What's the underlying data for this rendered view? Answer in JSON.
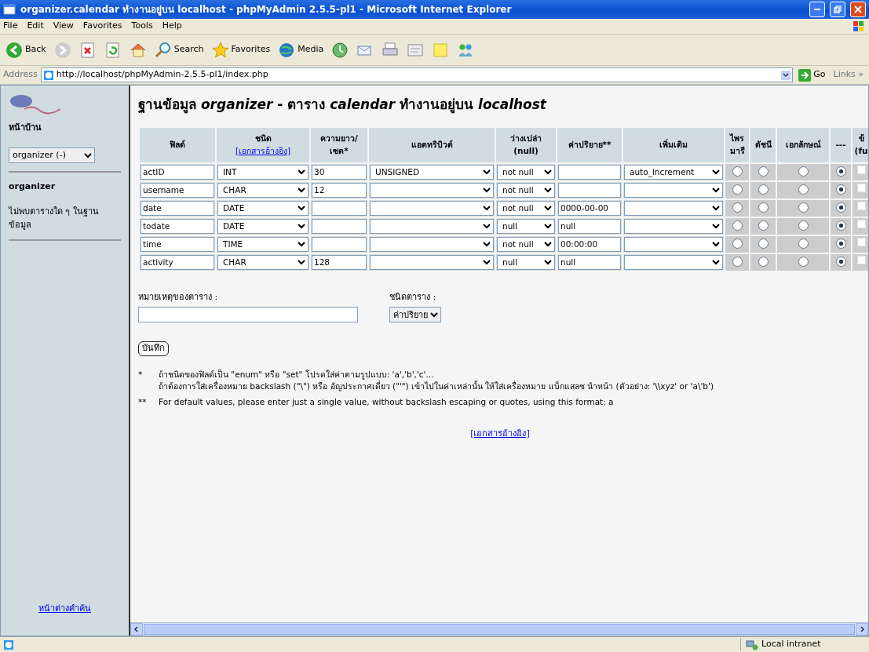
{
  "window": {
    "title": "organizer.calendar ทำงานอยู่บน localhost - phpMyAdmin 2.5.5-pl1 - Microsoft Internet Explorer"
  },
  "menu": [
    "File",
    "Edit",
    "View",
    "Favorites",
    "Tools",
    "Help"
  ],
  "toolbar": [
    {
      "kind": "back",
      "label": "Back"
    },
    {
      "kind": "forward"
    },
    {
      "kind": "stop"
    },
    {
      "kind": "refresh"
    },
    {
      "kind": "home"
    },
    {
      "kind": "search",
      "label": "Search"
    },
    {
      "kind": "favorites",
      "label": "Favorites"
    },
    {
      "kind": "media",
      "label": "Media"
    },
    {
      "kind": "history"
    },
    {
      "kind": "mail"
    },
    {
      "kind": "print"
    },
    {
      "kind": "edit"
    },
    {
      "kind": "note"
    },
    {
      "kind": "people"
    }
  ],
  "address": {
    "label": "Address",
    "url": "http://localhost/phpMyAdmin-2.5.5-pl1/index.php",
    "go": "Go",
    "links": "Links",
    "links_more": "»"
  },
  "sidebar": {
    "home": "หน้าบ้าน",
    "db_select": "organizer (-)",
    "db_name": "organizer",
    "no_tables": "ไม่พบตารางใด ๆ ในฐานข้อมูล",
    "query_window": "หน้าต่างคำค้น"
  },
  "heading": "ฐานข้อมูล *organizer* - ตาราง *calendar* ทำงานอยู่บน *localhost*",
  "table": {
    "columns": [
      {
        "label": "ฟิลด์"
      },
      {
        "label": "ชนิด",
        "link": "[เอกสารอ้างอิง]"
      },
      {
        "label": "ความยาว/\nเซต*"
      },
      {
        "label": "แอตทริบิวต์"
      },
      {
        "label": "ว่างเปล่า\n(null)"
      },
      {
        "label": "ค่าปริยาย**"
      },
      {
        "label": "เพิ่มเติม"
      },
      {
        "label": "ไพร\nมารี"
      },
      {
        "label": "ดัชนี"
      },
      {
        "label": "เอกลักษณ์"
      },
      {
        "label": "---"
      },
      {
        "label": "ข้\n(fu"
      }
    ],
    "rows": [
      {
        "field": "actID",
        "type": "INT",
        "length": "30",
        "attribute": "UNSIGNED",
        "null": "not null",
        "default": "",
        "extra": "auto_increment",
        "keys": [
          {
            "selected": false
          },
          {
            "selected": false
          },
          {
            "selected": false
          },
          {
            "selected": true
          }
        ],
        "fulltext": false
      },
      {
        "field": "username",
        "type": "CHAR",
        "length": "12",
        "attribute": "",
        "null": "not null",
        "default": "",
        "extra": "",
        "keys": [
          {
            "selected": false
          },
          {
            "selected": false
          },
          {
            "selected": false
          },
          {
            "selected": true
          }
        ],
        "fulltext": false
      },
      {
        "field": "date",
        "type": "DATE",
        "length": "",
        "attribute": "",
        "null": "not null",
        "default": "0000-00-00",
        "extra": "",
        "keys": [
          {
            "selected": false
          },
          {
            "selected": false
          },
          {
            "selected": false
          },
          {
            "selected": true
          }
        ],
        "fulltext": false
      },
      {
        "field": "todate",
        "type": "DATE",
        "length": "",
        "attribute": "",
        "null": "null",
        "default": "null",
        "extra": "",
        "keys": [
          {
            "selected": false
          },
          {
            "selected": false
          },
          {
            "selected": false
          },
          {
            "selected": true
          }
        ],
        "fulltext": false
      },
      {
        "field": "time",
        "type": "TIME",
        "length": "",
        "attribute": "",
        "null": "not null",
        "default": "00:00:00",
        "extra": "",
        "keys": [
          {
            "selected": false
          },
          {
            "selected": false
          },
          {
            "selected": false
          },
          {
            "selected": true
          }
        ],
        "fulltext": false
      },
      {
        "field": "activity",
        "type": "CHAR",
        "length": "128",
        "attribute": "",
        "null": "null",
        "default": "null",
        "extra": "",
        "keys": [
          {
            "selected": false
          },
          {
            "selected": false
          },
          {
            "selected": false
          },
          {
            "selected": true
          }
        ],
        "fulltext": false
      }
    ]
  },
  "comment": {
    "label": "หมายเหตุของตาราง :"
  },
  "table_type": {
    "label": "ชนิดตาราง :",
    "value": "ค่าปริยาย"
  },
  "save_button": "บันทึก",
  "notes": [
    {
      "mark": "*",
      "lines": [
        "ถ้าชนิดของฟิลด์เป็น \"enum\" หรือ \"set\" โปรดใส่ค่าตามรูปแบบ: 'a','b','c'...",
        "ถ้าต้องการใส่เครื่องหมาย backslash (\"\\\") หรือ อัญประกาศเดี่ยว (\"'\") เข้าไปในค่าเหล่านั้น ให้ใส่เครื่องหมาย แบ็กแสลช นำหน้า (ตัวอย่าง: '\\\\xyz' or 'a\\'b')"
      ]
    },
    {
      "mark": "**",
      "lines": [
        "For default values, please enter just a single value, without backslash escaping or quotes, using this format: a"
      ]
    }
  ],
  "doc_link": "[เอกสารอ้างอิง]",
  "status_bar": {
    "zone": "Local intranet"
  }
}
